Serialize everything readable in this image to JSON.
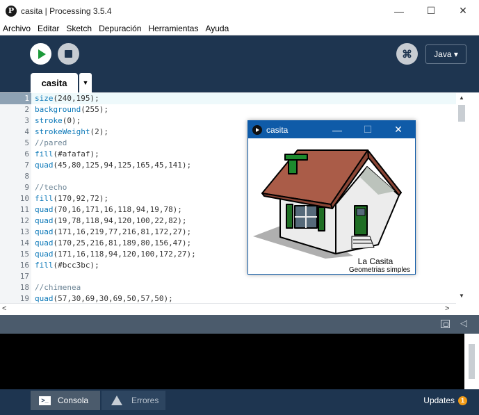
{
  "window": {
    "title": "casita | Processing 3.5.4",
    "logo_letter": "P",
    "minimize_glyph": "—",
    "maximize_glyph": "☐",
    "close_glyph": "✕"
  },
  "menu": [
    "Archivo",
    "Editar",
    "Sketch",
    "Depuración",
    "Herramientas",
    "Ayuda"
  ],
  "toolbar": {
    "debug_glyph": "⌘",
    "mode_label": "Java ▾",
    "tab_label": "casita",
    "tab_menu_glyph": "▼"
  },
  "editor": {
    "current_line": 1,
    "lines": [
      {
        "n": "1",
        "code": "size(240,195);"
      },
      {
        "n": "2",
        "code": "background(255);"
      },
      {
        "n": "3",
        "code": "stroke(0);"
      },
      {
        "n": "4",
        "code": "strokeWeight(2);"
      },
      {
        "n": "5",
        "code": "//pared"
      },
      {
        "n": "6",
        "code": "fill(#afafaf);"
      },
      {
        "n": "7",
        "code": "quad(45,80,125,94,125,165,45,141);"
      },
      {
        "n": "8",
        "code": ""
      },
      {
        "n": "9",
        "code": "//techo"
      },
      {
        "n": "10",
        "code": "fill(170,92,72);"
      },
      {
        "n": "11",
        "code": "quad(70,16,171,16,118,94,19,78);"
      },
      {
        "n": "12",
        "code": "quad(19,78,118,94,120,100,22,82);"
      },
      {
        "n": "13",
        "code": "quad(171,16,219,77,216,81,172,27);"
      },
      {
        "n": "14",
        "code": "quad(170,25,216,81,189,80,156,47);"
      },
      {
        "n": "15",
        "code": "quad(171,16,118,94,120,100,172,27);"
      },
      {
        "n": "16",
        "code": "fill(#bcc3bc);"
      },
      {
        "n": "17",
        "code": ""
      },
      {
        "n": "18",
        "code": "//chimenea"
      },
      {
        "n": "19",
        "code": "quad(57,30,69,30,69,50,57,50);"
      }
    ]
  },
  "sketch_window": {
    "title": "casita",
    "caption_line1": "La Casita",
    "caption_line2": "Geometrias simples",
    "colors": {
      "roof": "#aa5c48",
      "roof_dark": "#8a4636",
      "wall": "#ececec",
      "wall_shade": "#bcc3bc",
      "shadow": "#afafaf",
      "chimney": "#1d8a2e",
      "window_frame": "#2c7a2c",
      "window_glass": "#566a7a",
      "door": "#1f6e24"
    }
  },
  "bottom": {
    "console_tab": "Consola",
    "errors_tab": "Errores",
    "updates_label": "Updates",
    "updates_count": "1"
  }
}
